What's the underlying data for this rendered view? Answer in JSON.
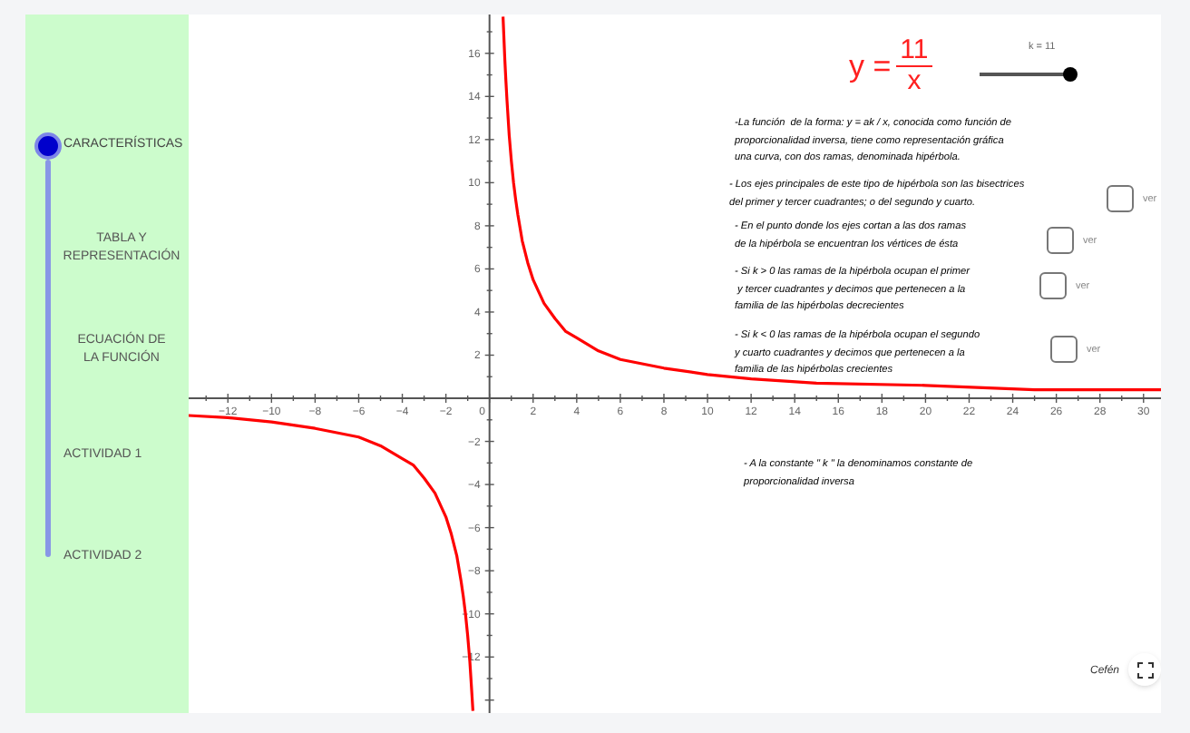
{
  "sidebar": {
    "items": [
      {
        "label": "CARACTERÍSTICAS",
        "selected": true
      },
      {
        "label": "TABLA Y\nREPRESENTACIÓN",
        "selected": false
      },
      {
        "label": "ECUACIÓN DE\nLA FUNCIÓN",
        "selected": false
      },
      {
        "label": "ACTIVIDAD 1",
        "selected": false
      },
      {
        "label": "ACTIVIDAD 2",
        "selected": false
      }
    ]
  },
  "formula": {
    "lhs": "y =",
    "numerator": "11",
    "denominator": "x"
  },
  "k_slider": {
    "label": "k = 11",
    "level": 1
  },
  "notes": [
    {
      "text": "-La función  de la forma: y = ak / x, conocida como función de\nproporcionalidad inversa, tiene como representación gráfica\nuna curva, con dos ramas, denominada hipérbola."
    },
    {
      "text": "- Los ejes principales de este tipo de hipérbola son las bisectrices\ndel primer y tercer cuadrantes; o del segundo y cuarto.",
      "checkbox": {
        "checked": false,
        "label": "ver"
      }
    },
    {
      "text": "- En el punto donde los ejes cortan a las dos ramas\nde la hipérbola se encuentran los vértices de ésta",
      "checkbox": {
        "checked": false,
        "label": "ver"
      }
    },
    {
      "text": "- Si k > 0 las ramas de la hipérbola ocupan el primer\n y tercer cuadrantes y decimos que pertenecen a la\nfamilia de las hipérbolas decrecientes",
      "checkbox": {
        "checked": false,
        "label": "ver"
      }
    },
    {
      "text": "- Si k < 0 las ramas de la hipérbola ocupan el segundo\ny cuarto cuadrantes y decimos que pertenecen a la\nfamilia de las hipérbolas crecientes",
      "checkbox": {
        "checked": false,
        "label": "ver"
      }
    },
    {
      "text": "- A la constante \" k \" la denominamos constante de\nproporcionalidad inversa"
    }
  ],
  "graph": {
    "chart_data": {
      "type": "line",
      "x": [
        -13.8,
        -12,
        -10,
        -8,
        -7,
        -6,
        -5,
        -4,
        -3.5,
        -3,
        -2.5,
        -2,
        -1.75,
        -1.5,
        -1.3,
        -1.2,
        -1.1,
        -1,
        -0.9,
        -0.8,
        -0.76,
        0,
        0.62,
        0.65,
        0.7,
        0.75,
        0.8,
        0.9,
        1,
        1.1,
        1.2,
        1.3,
        1.5,
        1.75,
        2,
        2.5,
        3,
        3.5,
        4,
        5,
        6,
        7,
        8,
        10,
        12,
        15,
        20,
        25,
        30.8
      ],
      "series": [
        {
          "color": "#ff0000",
          "values": [
            -0.8,
            -0.9,
            -1.1,
            -1.4,
            -1.6,
            -1.8,
            -2.2,
            -2.8,
            -3.1,
            -3.7,
            -4.4,
            -5.5,
            -6.3,
            -7.3,
            -8.5,
            -9.2,
            -10,
            -11,
            -12.2,
            -13.8,
            -14.5,
            null,
            17.7,
            16.9,
            15.7,
            14.7,
            13.8,
            12.2,
            11,
            10,
            9.2,
            8.5,
            7.3,
            6.3,
            5.5,
            4.4,
            3.7,
            3.1,
            2.8,
            2.2,
            1.8,
            1.6,
            1.4,
            1.1,
            0.9,
            0.7,
            0.6,
            0.4,
            0.4
          ]
        }
      ],
      "xlim": [
        -13.8,
        30.8
      ],
      "ylim": [
        -14.6,
        17.8
      ],
      "xticks": [
        {
          "value": -12,
          "label": "−12"
        },
        {
          "value": -10,
          "label": "−10"
        },
        {
          "value": -8,
          "label": "−8"
        },
        {
          "value": -6,
          "label": "−6"
        },
        {
          "value": -4,
          "label": "−4"
        },
        {
          "value": -2,
          "label": "−2"
        },
        0,
        2,
        4,
        6,
        8,
        10,
        12,
        14,
        16,
        18,
        20,
        22,
        24,
        26,
        28,
        30
      ],
      "yticks": [
        {
          "value": -12,
          "label": "−12"
        },
        {
          "value": -10,
          "label": "−10"
        },
        {
          "value": -8,
          "label": "−8"
        },
        {
          "value": -6,
          "label": "−6"
        },
        {
          "value": -4,
          "label": "−4"
        },
        {
          "value": -2,
          "label": "−2"
        },
        2,
        4,
        6,
        8,
        10,
        12,
        14,
        16
      ]
    }
  },
  "footer": {
    "credit": "Cefén"
  }
}
